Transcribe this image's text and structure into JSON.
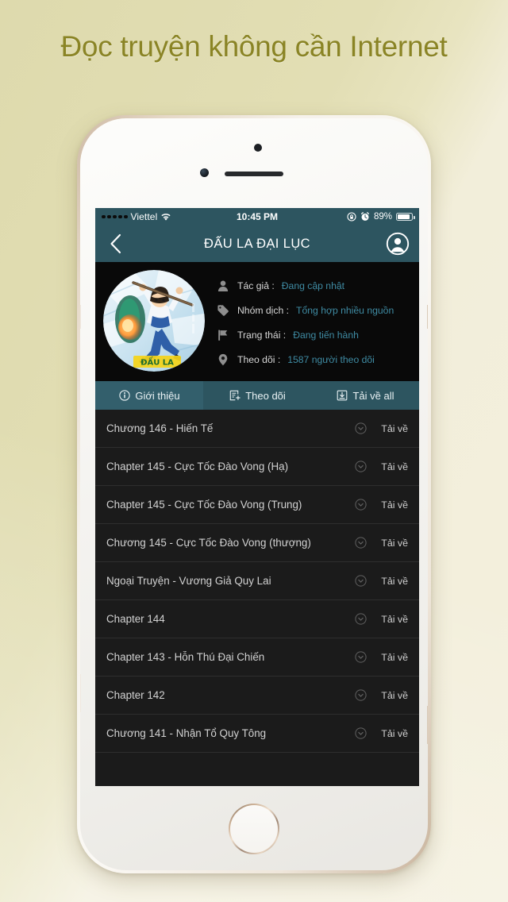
{
  "promo": {
    "headline": "Đọc truyện không cần Internet",
    "bg_color_left": "#dedaad",
    "bg_color_right": "#f4f0de",
    "headline_color": "#8a8425"
  },
  "status_bar": {
    "carrier": "Viettel",
    "signal_dots": 5,
    "wifi_icon": "wifi-icon",
    "time": "10:45 PM",
    "rotation_lock_icon": "rotation-lock-icon",
    "alarm_icon": "alarm-clock-icon",
    "battery_percent": "89%",
    "battery_level": 89
  },
  "nav_bar": {
    "back_icon": "chevron-left-icon",
    "title": "ĐẤU LA ĐẠI LỤC",
    "profile_icon": "user-circle-icon",
    "bg_color": "#2d5560"
  },
  "info_panel": {
    "cover_thumb_alt": "manga-cover-thumbnail",
    "rows": [
      {
        "icon": "person-icon",
        "label": "Tác giả :",
        "value": "Đang cập nhật"
      },
      {
        "icon": "tag-icon",
        "label": "Nhóm dịch :",
        "value": "Tổng hợp nhiều nguồn"
      },
      {
        "icon": "flag-icon",
        "label": "Trạng thái :",
        "value": "Đang tiến hành"
      },
      {
        "icon": "location-icon",
        "label": "Theo dõi :",
        "value": "1587 người theo dõi"
      }
    ],
    "value_color": "#3f8ba3"
  },
  "tabs": [
    {
      "icon": "info-circle-icon",
      "label": "Giới thiệu",
      "active": true
    },
    {
      "icon": "add-to-list-icon",
      "label": "Theo dõi",
      "active": false
    },
    {
      "icon": "download-box-icon",
      "label": "Tải về all",
      "active": false
    }
  ],
  "chapter_list": {
    "download_icon": "download-circle-icon",
    "download_label": "Tải về",
    "rows": [
      {
        "title": "Chương 146 - Hiến Tế"
      },
      {
        "title": "Chapter 145 - Cực Tốc Đào Vong (Hạ)"
      },
      {
        "title": "Chapter 145 - Cực Tốc Đào Vong (Trung)"
      },
      {
        "title": "Chương 145 - Cực Tốc Đào Vong (thượng)"
      },
      {
        "title": "Ngoại Truyện - Vương Giả Quy Lai"
      },
      {
        "title": "Chapter 144"
      },
      {
        "title": "Chapter 143 - Hỗn Thú Đại Chiến"
      },
      {
        "title": "Chapter 142"
      },
      {
        "title": "Chương 141 - Nhận Tổ Quy Tông"
      },
      {
        "title": ""
      }
    ]
  },
  "device": {
    "frame_color": "#e6d9c8",
    "home_button_label": "home-button"
  }
}
